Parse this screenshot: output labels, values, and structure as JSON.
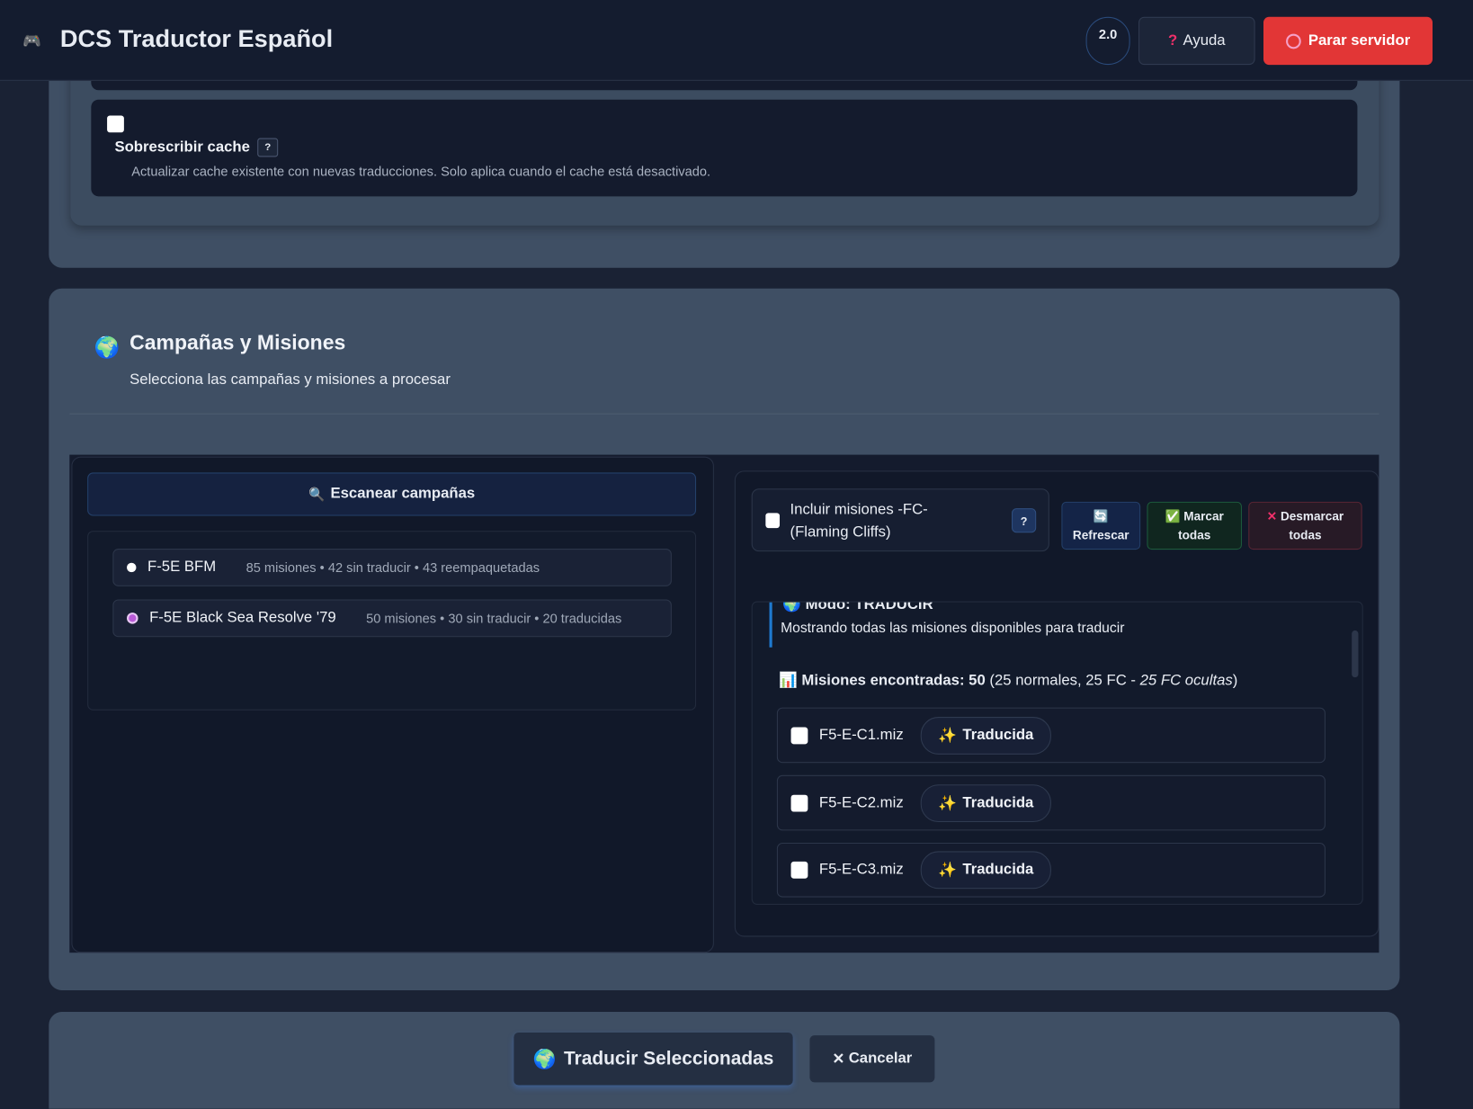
{
  "header": {
    "title": "DCS Traductor Español",
    "version": "2.0",
    "help_label": "Ayuda",
    "stop_label": "Parar servidor"
  },
  "cache": {
    "label": "Sobrescribir cache",
    "help": "?",
    "description": "Actualizar cache existente con nuevas traducciones. Solo aplica cuando el cache está desactivado.",
    "checked": false
  },
  "section": {
    "title": "Campañas y Misiones",
    "subtitle": "Selecciona las campañas y misiones a procesar"
  },
  "left": {
    "scan_label": "Escanear campañas",
    "campaigns": [
      {
        "name": "F-5E BFM",
        "meta": "85 misiones • 42 sin traducir • 43 reempaquetadas",
        "selected": false
      },
      {
        "name": "F-5E Black Sea Resolve '79",
        "meta": "50 misiones • 30 sin traducir • 20 traducidas",
        "selected": true
      }
    ]
  },
  "right": {
    "fc_label_1": "Incluir misiones -FC-",
    "fc_label_2": "(Flaming Cliffs)",
    "fc_help": "?",
    "refresh_label": "Refrescar",
    "mark_1": "Marcar",
    "mark_2": "todas",
    "unmark_1": "Desmarcar",
    "unmark_2": "todas",
    "mode_title": "Modo: TRADUCIR",
    "mode_desc": "Mostrando todas las misiones disponibles para traducir",
    "found_label": "Misiones encontradas: 50",
    "found_detail": " (25 normales, 25 FC - ",
    "found_hidden": "25 FC ocultas",
    "found_close": ")",
    "missions": [
      {
        "file": "F5-E-C1.miz",
        "status": "Traducida"
      },
      {
        "file": "F5-E-C2.miz",
        "status": "Traducida"
      },
      {
        "file": "F5-E-C3.miz",
        "status": "Traducida"
      }
    ]
  },
  "footer": {
    "translate_label": "Traducir Seleccionadas",
    "cancel_label": "Cancelar"
  },
  "colors": {
    "accent": "#e23636",
    "bg": "#1a2234",
    "card": "#3f4f64",
    "selected_radio": "#b85ad6"
  }
}
